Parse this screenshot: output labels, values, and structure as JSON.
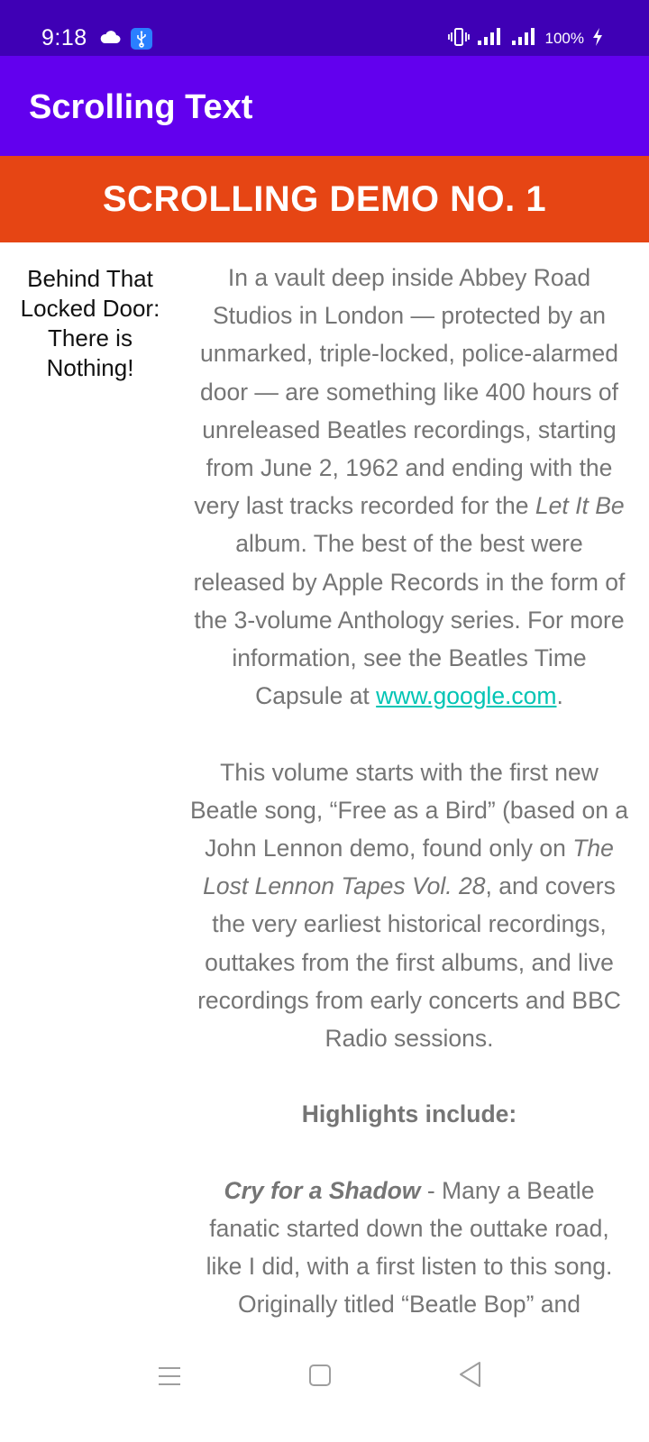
{
  "status_bar": {
    "time": "9:18",
    "battery": "100%",
    "icons": [
      "cloud-icon",
      "usb-icon",
      "vibrate-icon",
      "signal-icon",
      "signal-icon",
      "charging-bolt-icon"
    ]
  },
  "app_bar": {
    "title": "Scrolling Text"
  },
  "banner": {
    "text": "SCROLLING DEMO NO. 1"
  },
  "side_note": {
    "line1": "Behind That",
    "line2": "Locked Door:",
    "line3": "There is",
    "line4": "Nothing!"
  },
  "article": {
    "p1_part1": "In a vault deep inside Abbey Road Studios in London — protected by an unmarked, triple-locked, police-alarmed door — are something like 400 hours of unreleased Beatles recordings, starting from June 2, 1962 and ending with the very last tracks recorded for the ",
    "p1_album": "Let It Be",
    "p1_part2": " album. The best of the best were released by Apple Records in the form of the 3-volume Anthology series. For more information, see the Beatles Time Capsule at ",
    "p1_link": "www.google.com",
    "p1_end": ".",
    "p2_part1": "This volume starts with the first new Beatle song, “Free as a Bird” (based on a John Lennon demo, found only on ",
    "p2_title": "The Lost Lennon Tapes Vol. 28",
    "p2_part2": ", and covers the very earliest historical recordings, outtakes from the first albums, and live recordings from early concerts and BBC Radio sessions.",
    "highlights_heading": "Highlights include:",
    "p3_title": "Cry for a Shadow",
    "p3_text": " - Many a Beatle fanatic started down the outtake road, like I did, with a first listen to this song. Originally titled “Beatle Bop” and recorded in a single session that yielded"
  },
  "colors": {
    "status_bar": "#3f00b5",
    "app_bar": "#6200ee",
    "banner": "#e64514",
    "link": "#00c4b4",
    "body_text": "#757575"
  },
  "nav_bar": {
    "icons": [
      "menu-icon",
      "home-icon",
      "back-icon"
    ]
  }
}
